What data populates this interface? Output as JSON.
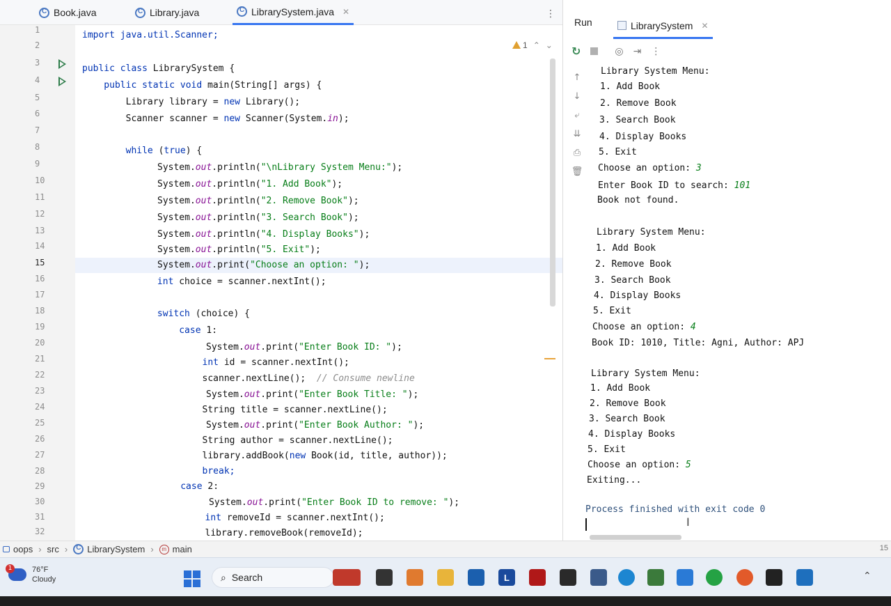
{
  "editor_tabs": [
    {
      "label": "Book.java"
    },
    {
      "label": "Library.java"
    },
    {
      "label": "LibrarySystem.java",
      "active": true
    }
  ],
  "warnings": {
    "count": "1"
  },
  "line_numbers": [
    "1",
    "2",
    "3",
    "4",
    "5",
    "6",
    "7",
    "8",
    "9",
    "10",
    "11",
    "12",
    "13",
    "14",
    "15",
    "16",
    "17",
    "18",
    "19",
    "20",
    "21",
    "22",
    "23",
    "24",
    "25",
    "26",
    "27",
    "28",
    "29",
    "30",
    "31",
    "32"
  ],
  "code": {
    "l1": "import java.util.Scanner;",
    "l3a": "public class ",
    "l3b": "LibrarySystem {",
    "l4a": "    public static void ",
    "l4b": "main(String[] args) {",
    "l5a": "        Library library = ",
    "l5b": "new ",
    "l5c": "Library();",
    "l6a": "        Scanner scanner = ",
    "l6b": "new ",
    "l6c": "Scanner(System.",
    "l6d": "in",
    "l6e": ");",
    "l8a": "        while ",
    "l8b": "(",
    "l8c": "true",
    "l8d": ") {",
    "l9_field": "out",
    "l9_lit": "\"\\nLibrary System Menu:\"",
    "l10_lit": "\"1. Add Book\"",
    "l11_lit": "\"2. Remove Book\"",
    "l12_lit": "\"3. Search Book\"",
    "l13_lit": "\"4. Display Books\"",
    "l14_lit": "\"5. Exit\"",
    "l15_lit": "\"Choose an option: \"",
    "l16a": "            int ",
    "l16b": "choice = scanner.nextInt();",
    "l18a": "            switch ",
    "l18b": "(choice) {",
    "l19a": "                case ",
    "l19b": "1:",
    "l20_lit": "\"Enter Book ID: \"",
    "l21a": "                    int ",
    "l21b": "id = scanner.nextInt();",
    "l22a": "                    scanner.nextLine();  ",
    "l22b": "// Consume newline",
    "l23_lit": "\"Enter Book Title: \"",
    "l24": "                    String title = scanner.nextLine();",
    "l25_lit": "\"Enter Book Author: \"",
    "l26": "                    String author = scanner.nextLine();",
    "l27a": "                    library.addBook(",
    "l27b": "new ",
    "l27c": "Book(id, title, author));",
    "l28": "                    break;",
    "l29a": "                case ",
    "l29b": "2:",
    "l30_lit": "\"Enter Book ID to remove: \"",
    "l31a": "                    int ",
    "l31b": "removeId = scanner.nextInt();",
    "l32": "                    library.removeBook(removeId);",
    "sys": "System.",
    "println": ".println(",
    "print": ".print(",
    "close": ");"
  },
  "run_panel": {
    "label": "Run",
    "tab": "LibrarySystem"
  },
  "console": [
    "Library System Menu:",
    "1. Add Book",
    "2. Remove Book",
    "3. Search Book",
    "4. Display Books",
    "5. Exit",
    "Choose an option: ",
    "3",
    "Enter Book ID to search: ",
    "101",
    "Book not found.",
    "Library System Menu:",
    "1. Add Book",
    "2. Remove Book",
    "3. Search Book",
    "4. Display Books",
    "5. Exit",
    "Choose an option: ",
    "4",
    "Book ID: 1010, Title: Agni, Author: APJ",
    "Library System Menu:",
    "1. Add Book",
    "2. Remove Book",
    "3. Search Book",
    "4. Display Books",
    "5. Exit",
    "Choose an option: ",
    "5",
    "Exiting...",
    "Process finished with exit code 0"
  ],
  "breadcrumb": {
    "project": "oops",
    "folder": "src",
    "class": "LibrarySystem",
    "method": "main",
    "right_fragment": "15"
  },
  "taskbar": {
    "weather_temp": "76°F",
    "weather_desc": "Cloudy",
    "weather_badge": "1",
    "search_label": "Search",
    "ms_store_letter": "L"
  },
  "colors": {
    "keyword": "#0033b3",
    "string": "#067d17",
    "field": "#871094",
    "accent": "#3574f0"
  }
}
